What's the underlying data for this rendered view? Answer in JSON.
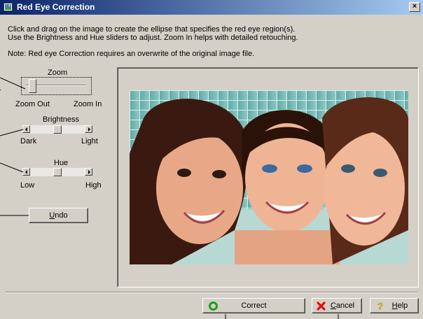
{
  "window": {
    "title": "Red Eye Correction",
    "close_glyph": "×",
    "icon": "image-app-icon"
  },
  "instructions": {
    "line1": "Click and drag on the image to create the ellipse that specifies the red eye region(s).",
    "line2": "Use the Brightness and Hue sliders to adjust.  Zoom In helps with detailed retouching.",
    "note": "Note: Red eye Correction requires an overwrite of the original image file."
  },
  "zoom": {
    "label": "Zoom",
    "min_label": "Zoom Out",
    "max_label": "Zoom In",
    "level": 0.05
  },
  "brightness": {
    "label": "Brightness",
    "min_label": "Dark",
    "max_label": "Light",
    "level": 0.5
  },
  "hue": {
    "label": "Hue",
    "min_label": "Low",
    "max_label": "High",
    "level": 0.5
  },
  "undo": {
    "label": "Undo",
    "mnemonic": "U"
  },
  "buttons": {
    "correct": {
      "label": "Correct",
      "icon": "green-circle-icon"
    },
    "cancel": {
      "label": "Cancel",
      "mnemonic": "C",
      "icon": "red-x-icon"
    },
    "help": {
      "label": "Help",
      "mnemonic": "H",
      "icon": "question-mark-icon"
    }
  },
  "preview": {
    "subject": "photo of three smiling girls"
  },
  "colors": {
    "titlebar_start": "#0a246a",
    "titlebar_end": "#a6caf0",
    "dialog_bg": "#d4d0c8"
  }
}
